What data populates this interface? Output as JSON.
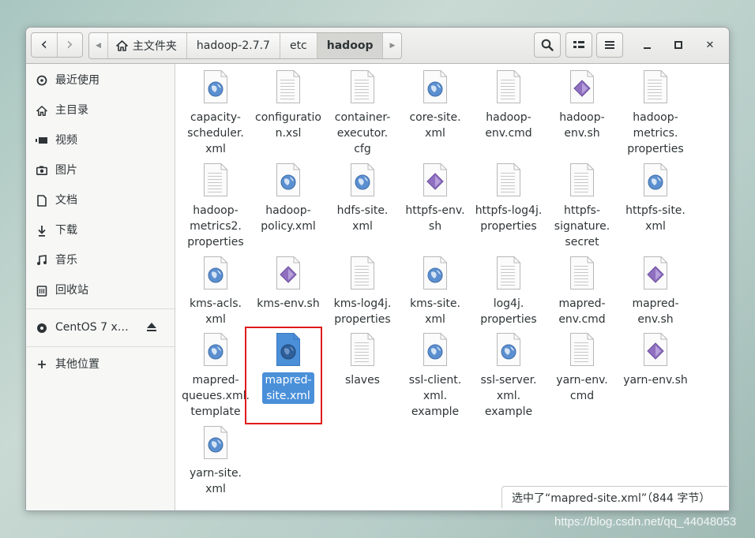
{
  "nav": {
    "back_glyph": "‹",
    "forward_glyph": "›"
  },
  "pathbar": {
    "left_arrow": "◀",
    "segments": [
      "主文件夹",
      "hadoop-2.7.7",
      "etc",
      "hadoop"
    ],
    "right_arrow": "▶"
  },
  "window_controls": {
    "minimize": "—",
    "maximize": "▫",
    "close": "✕"
  },
  "sidebar": {
    "items": [
      {
        "label": "最近使用",
        "icon": "clock-icon"
      },
      {
        "label": "主目录",
        "icon": "home-icon"
      },
      {
        "label": "视频",
        "icon": "video-icon"
      },
      {
        "label": "图片",
        "icon": "camera-icon"
      },
      {
        "label": "文档",
        "icon": "document-icon"
      },
      {
        "label": "下载",
        "icon": "download-icon"
      },
      {
        "label": "音乐",
        "icon": "music-icon"
      },
      {
        "label": "回收站",
        "icon": "trash-icon"
      },
      {
        "label": "CentOS 7 x…",
        "icon": "disc-icon"
      },
      {
        "label": "其他位置",
        "icon": "plus-icon"
      }
    ]
  },
  "files": [
    {
      "lines": [
        "capacity-",
        "scheduler.",
        "xml"
      ],
      "type": "xml"
    },
    {
      "lines": [
        "configuratio",
        "n.xsl"
      ],
      "type": "text"
    },
    {
      "lines": [
        "container-",
        "executor.",
        "cfg"
      ],
      "type": "text"
    },
    {
      "lines": [
        "core-site.",
        "xml"
      ],
      "type": "xml"
    },
    {
      "lines": [
        "hadoop-",
        "env.cmd"
      ],
      "type": "text"
    },
    {
      "lines": [
        "hadoop-",
        "env.sh"
      ],
      "type": "script"
    },
    {
      "lines": [
        "hadoop-",
        "metrics.",
        "properties"
      ],
      "type": "text"
    },
    {
      "lines": [
        "hadoop-",
        "metrics2.",
        "properties"
      ],
      "type": "text"
    },
    {
      "lines": [
        "hadoop-",
        "policy.xml"
      ],
      "type": "xml"
    },
    {
      "lines": [
        "hdfs-site.",
        "xml"
      ],
      "type": "xml"
    },
    {
      "lines": [
        "httpfs-env.",
        "sh"
      ],
      "type": "script"
    },
    {
      "lines": [
        "httpfs-log4j.",
        "properties"
      ],
      "type": "text"
    },
    {
      "lines": [
        "httpfs-",
        "signature.",
        "secret"
      ],
      "type": "text"
    },
    {
      "lines": [
        "httpfs-site.",
        "xml"
      ],
      "type": "xml"
    },
    {
      "lines": [
        "kms-acls.",
        "xml"
      ],
      "type": "xml"
    },
    {
      "lines": [
        "kms-env.sh"
      ],
      "type": "script"
    },
    {
      "lines": [
        "kms-log4j.",
        "properties"
      ],
      "type": "text"
    },
    {
      "lines": [
        "kms-site.",
        "xml"
      ],
      "type": "xml"
    },
    {
      "lines": [
        "log4j.",
        "properties"
      ],
      "type": "text"
    },
    {
      "lines": [
        "mapred-",
        "env.cmd"
      ],
      "type": "text"
    },
    {
      "lines": [
        "mapred-",
        "env.sh"
      ],
      "type": "script"
    },
    {
      "lines": [
        "mapred-",
        "queues.xml.",
        "template"
      ],
      "type": "xml"
    },
    {
      "lines": [
        "mapred-",
        "site.xml"
      ],
      "type": "xml",
      "selected": true
    },
    {
      "lines": [
        "slaves"
      ],
      "type": "text"
    },
    {
      "lines": [
        "ssl-client.",
        "xml.",
        "example"
      ],
      "type": "xml"
    },
    {
      "lines": [
        "ssl-server.",
        "xml.",
        "example"
      ],
      "type": "xml"
    },
    {
      "lines": [
        "yarn-env.",
        "cmd"
      ],
      "type": "text"
    },
    {
      "lines": [
        "yarn-env.sh"
      ],
      "type": "script"
    },
    {
      "lines": [
        "yarn-site.",
        "xml"
      ],
      "type": "xml"
    }
  ],
  "status": {
    "text": "选中了“mapred-site.xml”（844 字节）"
  },
  "watermark": "https://blog.csdn.net/qq_44048053"
}
